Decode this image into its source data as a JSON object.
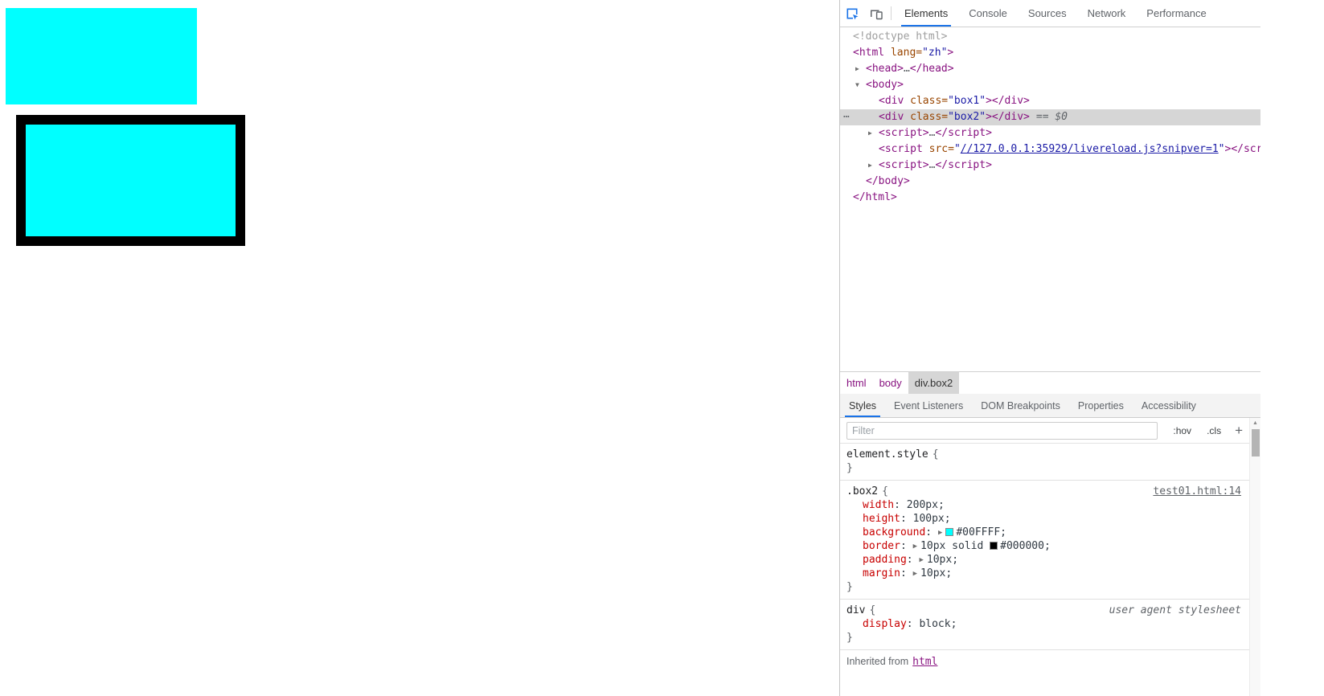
{
  "page": {
    "box1": {
      "color": "#00FFFF"
    },
    "box2": {
      "color": "#00FFFF",
      "border_color": "#000000"
    }
  },
  "devtools": {
    "main_tabs": [
      "Elements",
      "Console",
      "Sources",
      "Network",
      "Performance"
    ],
    "active_main_tab": "Elements",
    "tree_icons": {
      "collapsed": "▶",
      "expanded": "▼",
      "more": "⋯"
    },
    "tree": {
      "r0": {
        "g": "<!doctype html>"
      },
      "r1": {
        "o": "<html",
        "a": " lang=",
        "v": "\"zh\"",
        "c": ">"
      },
      "r2": {
        "o": "<head>",
        "e": "…",
        "c": "</head>"
      },
      "r3": {
        "o": "<body>"
      },
      "r4": {
        "o": "<div",
        "a": " class=",
        "v": "\"box1\"",
        "c": "></div>"
      },
      "r5": {
        "o": "<div",
        "a": " class=",
        "v": "\"box2\"",
        "c": "></div>",
        "f": "== $0"
      },
      "r6": {
        "o": "<script>",
        "e": "…",
        "c": "</script>"
      },
      "r7": {
        "o": "<script",
        "a": " src=",
        "q1": "\"",
        "link": "//127.0.0.1:35929/livereload.js?snipver=1",
        "q2": "\"",
        "c": "></script>"
      },
      "r8": {
        "o": "<script>",
        "e": "…",
        "c": "</script>"
      },
      "r9": {
        "c": "</body>"
      },
      "r10": {
        "c": "</html>"
      }
    },
    "breadcrumbs": [
      "html",
      "body",
      "div.box2"
    ],
    "selected_breadcrumb": "div.box2",
    "sidebar_tabs": [
      "Styles",
      "Event Listeners",
      "DOM Breakpoints",
      "Properties",
      "Accessibility"
    ],
    "active_sidebar_tab": "Styles",
    "filter": {
      "placeholder": "Filter",
      "hov": ":hov",
      "cls": ".cls",
      "plus": "+"
    },
    "punct": {
      "open": "{",
      "close": "}",
      "colon": ": ",
      "semi": ";",
      "arrow": "▶"
    },
    "scrollbar": {
      "up": "▲"
    },
    "styles": {
      "element_style": {
        "selector": "element.style"
      },
      "box2_rule": {
        "selector": ".box2",
        "source": "test01.html:14",
        "props": {
          "width": {
            "name": "width",
            "value": "200px"
          },
          "height": {
            "name": "height",
            "value": "100px"
          },
          "background": {
            "name": "background",
            "value": "#00FFFF",
            "swatch": "#00FFFF"
          },
          "border": {
            "name": "border",
            "pre": "10px solid ",
            "value": "#000000",
            "swatch": "#000000"
          },
          "padding": {
            "name": "padding",
            "value": "10px"
          },
          "margin": {
            "name": "margin",
            "value": "10px"
          }
        }
      },
      "div_rule": {
        "selector": "div",
        "source": "user agent stylesheet",
        "props": {
          "display": {
            "name": "display",
            "value": "block"
          }
        }
      },
      "inherited": {
        "label": "Inherited from",
        "node": "html"
      }
    },
    "colors": {
      "accent": "#1a73e8",
      "selection": "#d6d6d6",
      "tag": "#881280",
      "attr_name": "#994500",
      "attr_value": "#1a1aa6",
      "property_name": "#c80000"
    }
  }
}
